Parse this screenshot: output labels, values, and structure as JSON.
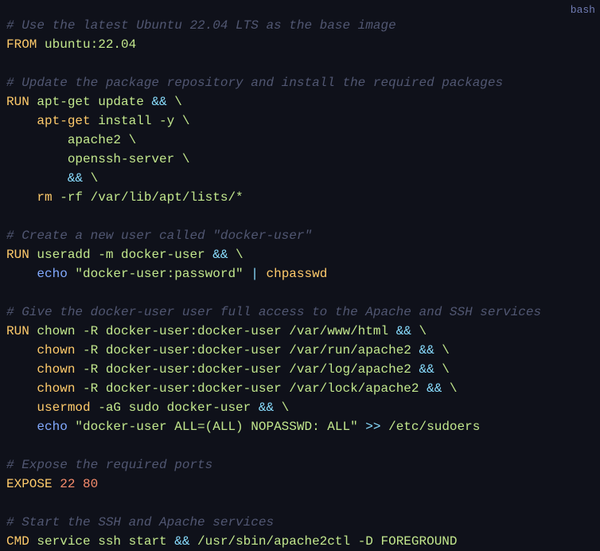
{
  "badge": "bash",
  "colors": {
    "background": "#0f111a",
    "comment": "#515772",
    "keyword": "#ffcb6b",
    "text": "#c3e88d",
    "operator": "#89ddff",
    "builtin": "#82aaff",
    "number": "#f78c6c"
  },
  "lines": [
    [
      {
        "t": "comment",
        "v": "# Use the latest Ubuntu 22.04 LTS as the base image"
      }
    ],
    [
      {
        "t": "keyword",
        "v": "FROM"
      },
      {
        "t": "text",
        "v": " ubuntu:22.04"
      }
    ],
    [],
    [
      {
        "t": "comment",
        "v": "# Update the package repository and install the required packages"
      }
    ],
    [
      {
        "t": "keyword",
        "v": "RUN"
      },
      {
        "t": "text",
        "v": " apt-get update "
      },
      {
        "t": "operator",
        "v": "&&"
      },
      {
        "t": "text",
        "v": " \\"
      }
    ],
    [
      {
        "t": "text",
        "v": "    "
      },
      {
        "t": "command",
        "v": "apt-get"
      },
      {
        "t": "text",
        "v": " install -y \\"
      }
    ],
    [
      {
        "t": "text",
        "v": "        apache2 \\"
      }
    ],
    [
      {
        "t": "text",
        "v": "        openssh-server \\"
      }
    ],
    [
      {
        "t": "text",
        "v": "        "
      },
      {
        "t": "operator",
        "v": "&&"
      },
      {
        "t": "text",
        "v": " \\"
      }
    ],
    [
      {
        "t": "text",
        "v": "    "
      },
      {
        "t": "command",
        "v": "rm"
      },
      {
        "t": "text",
        "v": " -rf /var/lib/apt/lists/*"
      }
    ],
    [],
    [
      {
        "t": "comment",
        "v": "# Create a new user called \"docker-user\""
      }
    ],
    [
      {
        "t": "keyword",
        "v": "RUN"
      },
      {
        "t": "text",
        "v": " useradd -m docker-user "
      },
      {
        "t": "operator",
        "v": "&&"
      },
      {
        "t": "text",
        "v": " \\"
      }
    ],
    [
      {
        "t": "text",
        "v": "    "
      },
      {
        "t": "builtin",
        "v": "echo"
      },
      {
        "t": "text",
        "v": " "
      },
      {
        "t": "string",
        "v": "\"docker-user:password\""
      },
      {
        "t": "text",
        "v": " "
      },
      {
        "t": "operator",
        "v": "|"
      },
      {
        "t": "text",
        "v": " "
      },
      {
        "t": "command",
        "v": "chpasswd"
      }
    ],
    [],
    [
      {
        "t": "comment",
        "v": "# Give the docker-user user full access to the Apache and SSH services"
      }
    ],
    [
      {
        "t": "keyword",
        "v": "RUN"
      },
      {
        "t": "text",
        "v": " chown -R docker-user:docker-user /var/www/html "
      },
      {
        "t": "operator",
        "v": "&&"
      },
      {
        "t": "text",
        "v": " \\"
      }
    ],
    [
      {
        "t": "text",
        "v": "    "
      },
      {
        "t": "command",
        "v": "chown"
      },
      {
        "t": "text",
        "v": " -R docker-user:docker-user /var/run/apache2 "
      },
      {
        "t": "operator",
        "v": "&&"
      },
      {
        "t": "text",
        "v": " \\"
      }
    ],
    [
      {
        "t": "text",
        "v": "    "
      },
      {
        "t": "command",
        "v": "chown"
      },
      {
        "t": "text",
        "v": " -R docker-user:docker-user /var/log/apache2 "
      },
      {
        "t": "operator",
        "v": "&&"
      },
      {
        "t": "text",
        "v": " \\"
      }
    ],
    [
      {
        "t": "text",
        "v": "    "
      },
      {
        "t": "command",
        "v": "chown"
      },
      {
        "t": "text",
        "v": " -R docker-user:docker-user /var/lock/apache2 "
      },
      {
        "t": "operator",
        "v": "&&"
      },
      {
        "t": "text",
        "v": " \\"
      }
    ],
    [
      {
        "t": "text",
        "v": "    "
      },
      {
        "t": "command",
        "v": "usermod"
      },
      {
        "t": "text",
        "v": " -aG sudo docker-user "
      },
      {
        "t": "operator",
        "v": "&&"
      },
      {
        "t": "text",
        "v": " \\"
      }
    ],
    [
      {
        "t": "text",
        "v": "    "
      },
      {
        "t": "builtin",
        "v": "echo"
      },
      {
        "t": "text",
        "v": " "
      },
      {
        "t": "string",
        "v": "\"docker-user ALL=(ALL) NOPASSWD: ALL\""
      },
      {
        "t": "text",
        "v": " "
      },
      {
        "t": "operator",
        "v": ">>"
      },
      {
        "t": "text",
        "v": " /etc/sudoers"
      }
    ],
    [],
    [
      {
        "t": "comment",
        "v": "# Expose the required ports"
      }
    ],
    [
      {
        "t": "keyword",
        "v": "EXPOSE"
      },
      {
        "t": "text",
        "v": " "
      },
      {
        "t": "number",
        "v": "22"
      },
      {
        "t": "text",
        "v": " "
      },
      {
        "t": "number",
        "v": "80"
      }
    ],
    [],
    [
      {
        "t": "comment",
        "v": "# Start the SSH and Apache services"
      }
    ],
    [
      {
        "t": "keyword",
        "v": "CMD"
      },
      {
        "t": "text",
        "v": " service ssh start "
      },
      {
        "t": "operator",
        "v": "&&"
      },
      {
        "t": "text",
        "v": " /usr/sbin/apache2ctl -D FOREGROUND"
      }
    ]
  ]
}
